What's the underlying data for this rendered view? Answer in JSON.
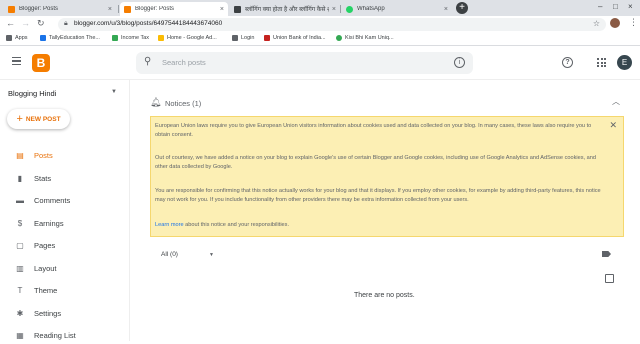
{
  "browser": {
    "tabs": [
      {
        "title": "Blogger: Posts",
        "favicon_color": "#f57d00",
        "active": false
      },
      {
        "title": "Blogger: Posts",
        "favicon_color": "#f57d00",
        "active": true
      },
      {
        "title": "ब्लॉगिंग क्या होता है और ब्लॉगिंग कैसे शुरु",
        "favicon_color": "#3c4043",
        "active": false
      },
      {
        "title": "WhatsApp",
        "favicon_color": "#25d366",
        "active": false
      }
    ],
    "new_tab": "+",
    "url": "blogger.com/u/3/blog/posts/6497544184443674060",
    "bookmarks": [
      {
        "label": "Apps",
        "color": "#5f6368"
      },
      {
        "label": "TallyEducation The...",
        "color": "#1a73e8"
      },
      {
        "label": "Income Tax",
        "color": "#34a853"
      },
      {
        "label": "Home - Google Ad...",
        "color": "#fbbc04"
      },
      {
        "label": "Login",
        "color": "#5f6368"
      },
      {
        "label": "Union Bank of India...",
        "color": "#c5221f"
      },
      {
        "label": "Kisi Bhi Kam Uniq...",
        "color": "#34a853"
      }
    ]
  },
  "header": {
    "logo_letter": "B",
    "search_placeholder": "Search posts",
    "account_initial": "E",
    "brand_color": "#f57d00"
  },
  "sidebar": {
    "blog_name": "Blogging Hindi",
    "new_post_label": "NEW POST",
    "items": [
      {
        "label": "Posts",
        "icon": "posts-icon",
        "glyph": "▤",
        "active": true
      },
      {
        "label": "Stats",
        "icon": "stats-icon",
        "glyph": "▮",
        "active": false
      },
      {
        "label": "Comments",
        "icon": "comments-icon",
        "glyph": "▬",
        "active": false
      },
      {
        "label": "Earnings",
        "icon": "earnings-icon",
        "glyph": "$",
        "active": false
      },
      {
        "label": "Pages",
        "icon": "pages-icon",
        "glyph": "▢",
        "active": false
      },
      {
        "label": "Layout",
        "icon": "layout-icon",
        "glyph": "▥",
        "active": false
      },
      {
        "label": "Theme",
        "icon": "theme-icon",
        "glyph": "T",
        "active": false
      },
      {
        "label": "Settings",
        "icon": "settings-icon",
        "glyph": "✱",
        "active": false
      },
      {
        "label": "Reading List",
        "icon": "reading-list-icon",
        "glyph": "▦",
        "active": false
      }
    ]
  },
  "notices": {
    "title": "Notices (1)",
    "paragraphs": [
      "European Union laws require you to give European Union visitors information about cookies used and data collected on your blog. In many cases, these laws also require you to obtain consent.",
      "Out of courtesy, we have added a notice on your blog to explain Google's use of certain Blogger and Google cookies, including use of Google Analytics and AdSense cookies, and other data collected by Google.",
      "You are responsible for confirming that this notice actually works for your blog and that it displays. If you employ other cookies, for example by adding third-party features, this notice may not work for you. If you include functionality from other providers there may be extra information collected from your users."
    ],
    "learn_more_link": "Learn more",
    "learn_more_rest": " about this notice and your responsibilities.",
    "background": "#fcefb4"
  },
  "posts": {
    "filter_label": "All (0)",
    "empty_message": "There are no posts."
  }
}
